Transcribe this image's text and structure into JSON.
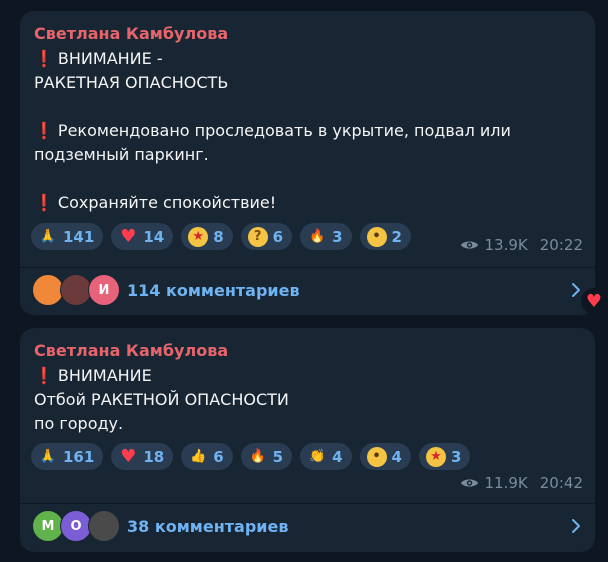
{
  "messages": [
    {
      "sender": "Светлана Камбулова",
      "lines": [
        {
          "excl": true,
          "text": "ВНИМАНИЕ -"
        },
        {
          "excl": false,
          "text": "РАКЕТНАЯ ОПАСНОСТЬ"
        },
        {
          "excl": false,
          "text": ""
        },
        {
          "excl": true,
          "text": "Рекомендовано проследовать в укрытие, подвал или"
        },
        {
          "excl": false,
          "text": "подземный паркинг."
        },
        {
          "excl": false,
          "text": ""
        },
        {
          "excl": true,
          "text": "Сохраняйте спокойствие!"
        }
      ],
      "reactions": [
        {
          "icon": "folded-hands-icon",
          "glyph": "🙏",
          "count": "141"
        },
        {
          "icon": "red-heart-icon",
          "glyph": "♥",
          "count": "14"
        },
        {
          "icon": "star-struck-icon",
          "glyph": "★",
          "count": "8"
        },
        {
          "icon": "thinking-face-icon",
          "glyph": "?",
          "count": "6"
        },
        {
          "icon": "fire-icon",
          "glyph": "🔥",
          "count": "3"
        },
        {
          "icon": "neutral-face-icon",
          "glyph": "•",
          "count": "2"
        }
      ],
      "views": "13.9K",
      "time": "20:22",
      "comments_label": "114 комментариев",
      "avatars": [
        {
          "letter": "",
          "color": "#f0883a"
        },
        {
          "letter": "",
          "color": "#6b3a3a"
        },
        {
          "letter": "И",
          "color": "#e8637a"
        }
      ]
    },
    {
      "sender": "Светлана Камбулова",
      "lines": [
        {
          "excl": true,
          "text": "ВНИМАНИЕ"
        },
        {
          "excl": false,
          "text": "Отбой РАКЕТНОЙ ОПАСНОСТИ"
        },
        {
          "excl": false,
          "text": "по городу."
        }
      ],
      "reactions": [
        {
          "icon": "folded-hands-icon",
          "glyph": "🙏",
          "count": "161"
        },
        {
          "icon": "red-heart-icon",
          "glyph": "♥",
          "count": "18"
        },
        {
          "icon": "thumbs-up-icon",
          "glyph": "👍",
          "count": "6"
        },
        {
          "icon": "fire-icon",
          "glyph": "🔥",
          "count": "5"
        },
        {
          "icon": "clapping-hands-icon",
          "glyph": "👏",
          "count": "4"
        },
        {
          "icon": "neutral-face-icon",
          "glyph": "•",
          "count": "4"
        },
        {
          "icon": "star-struck-icon",
          "glyph": "★",
          "count": "3"
        }
      ],
      "views": "11.9K",
      "time": "20:42",
      "comments_label": "38 комментариев",
      "avatars": [
        {
          "letter": "М",
          "color": "#5fb34a"
        },
        {
          "letter": "О",
          "color": "#7b5ed6"
        },
        {
          "letter": "",
          "color": "#4a4a4a"
        }
      ]
    }
  ],
  "colors": {
    "background": "#0e1621",
    "bubble": "#182533",
    "sender": "#e8646b",
    "accent": "#6fb3f2",
    "pill": "#2a3c52",
    "meta": "#7b8b9b",
    "excl": "#d9262c"
  },
  "floating_reaction": {
    "icon": "red-heart-icon",
    "glyph": "♥"
  }
}
